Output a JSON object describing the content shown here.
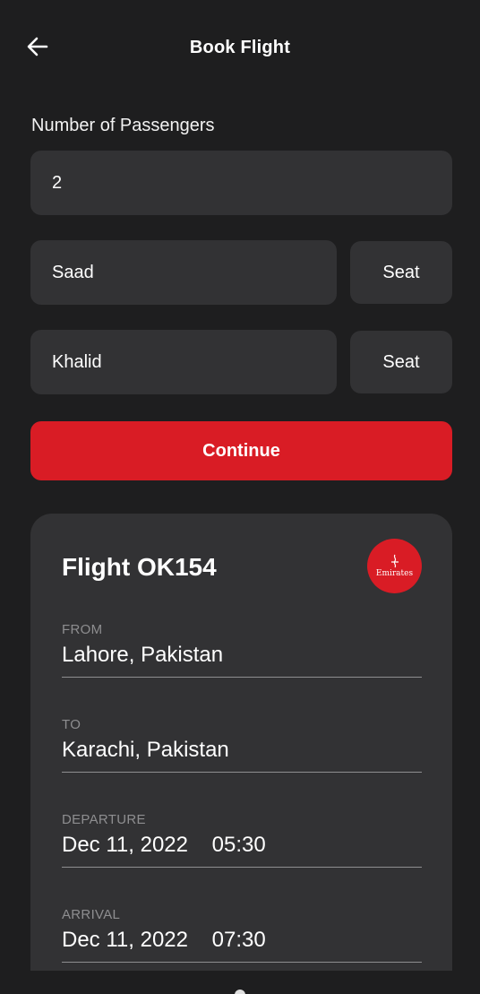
{
  "header": {
    "title": "Book Flight"
  },
  "passengers": {
    "label": "Number of Passengers",
    "count": "2",
    "list": [
      {
        "name": "Saad",
        "seat_label": "Seat"
      },
      {
        "name": "Khalid",
        "seat_label": "Seat"
      }
    ]
  },
  "actions": {
    "continue_label": "Continue"
  },
  "flight": {
    "title": "Flight OK154",
    "airline_logo_text": "Emirates",
    "from_label": "FROM",
    "from_value": "Lahore, Pakistan",
    "to_label": "TO",
    "to_value": "Karachi, Pakistan",
    "departure_label": "DEPARTURE",
    "departure_value": "Dec 11, 2022    05:30",
    "arrival_label": "ARRIVAL",
    "arrival_value": "Dec 11, 2022    07:30"
  },
  "colors": {
    "background": "#1e1e1f",
    "surface": "#323234",
    "accent": "#d91c25",
    "muted_text": "#8e8e90"
  },
  "icons": {
    "back": "arrow-left-icon",
    "airline": "emirates-logo"
  }
}
